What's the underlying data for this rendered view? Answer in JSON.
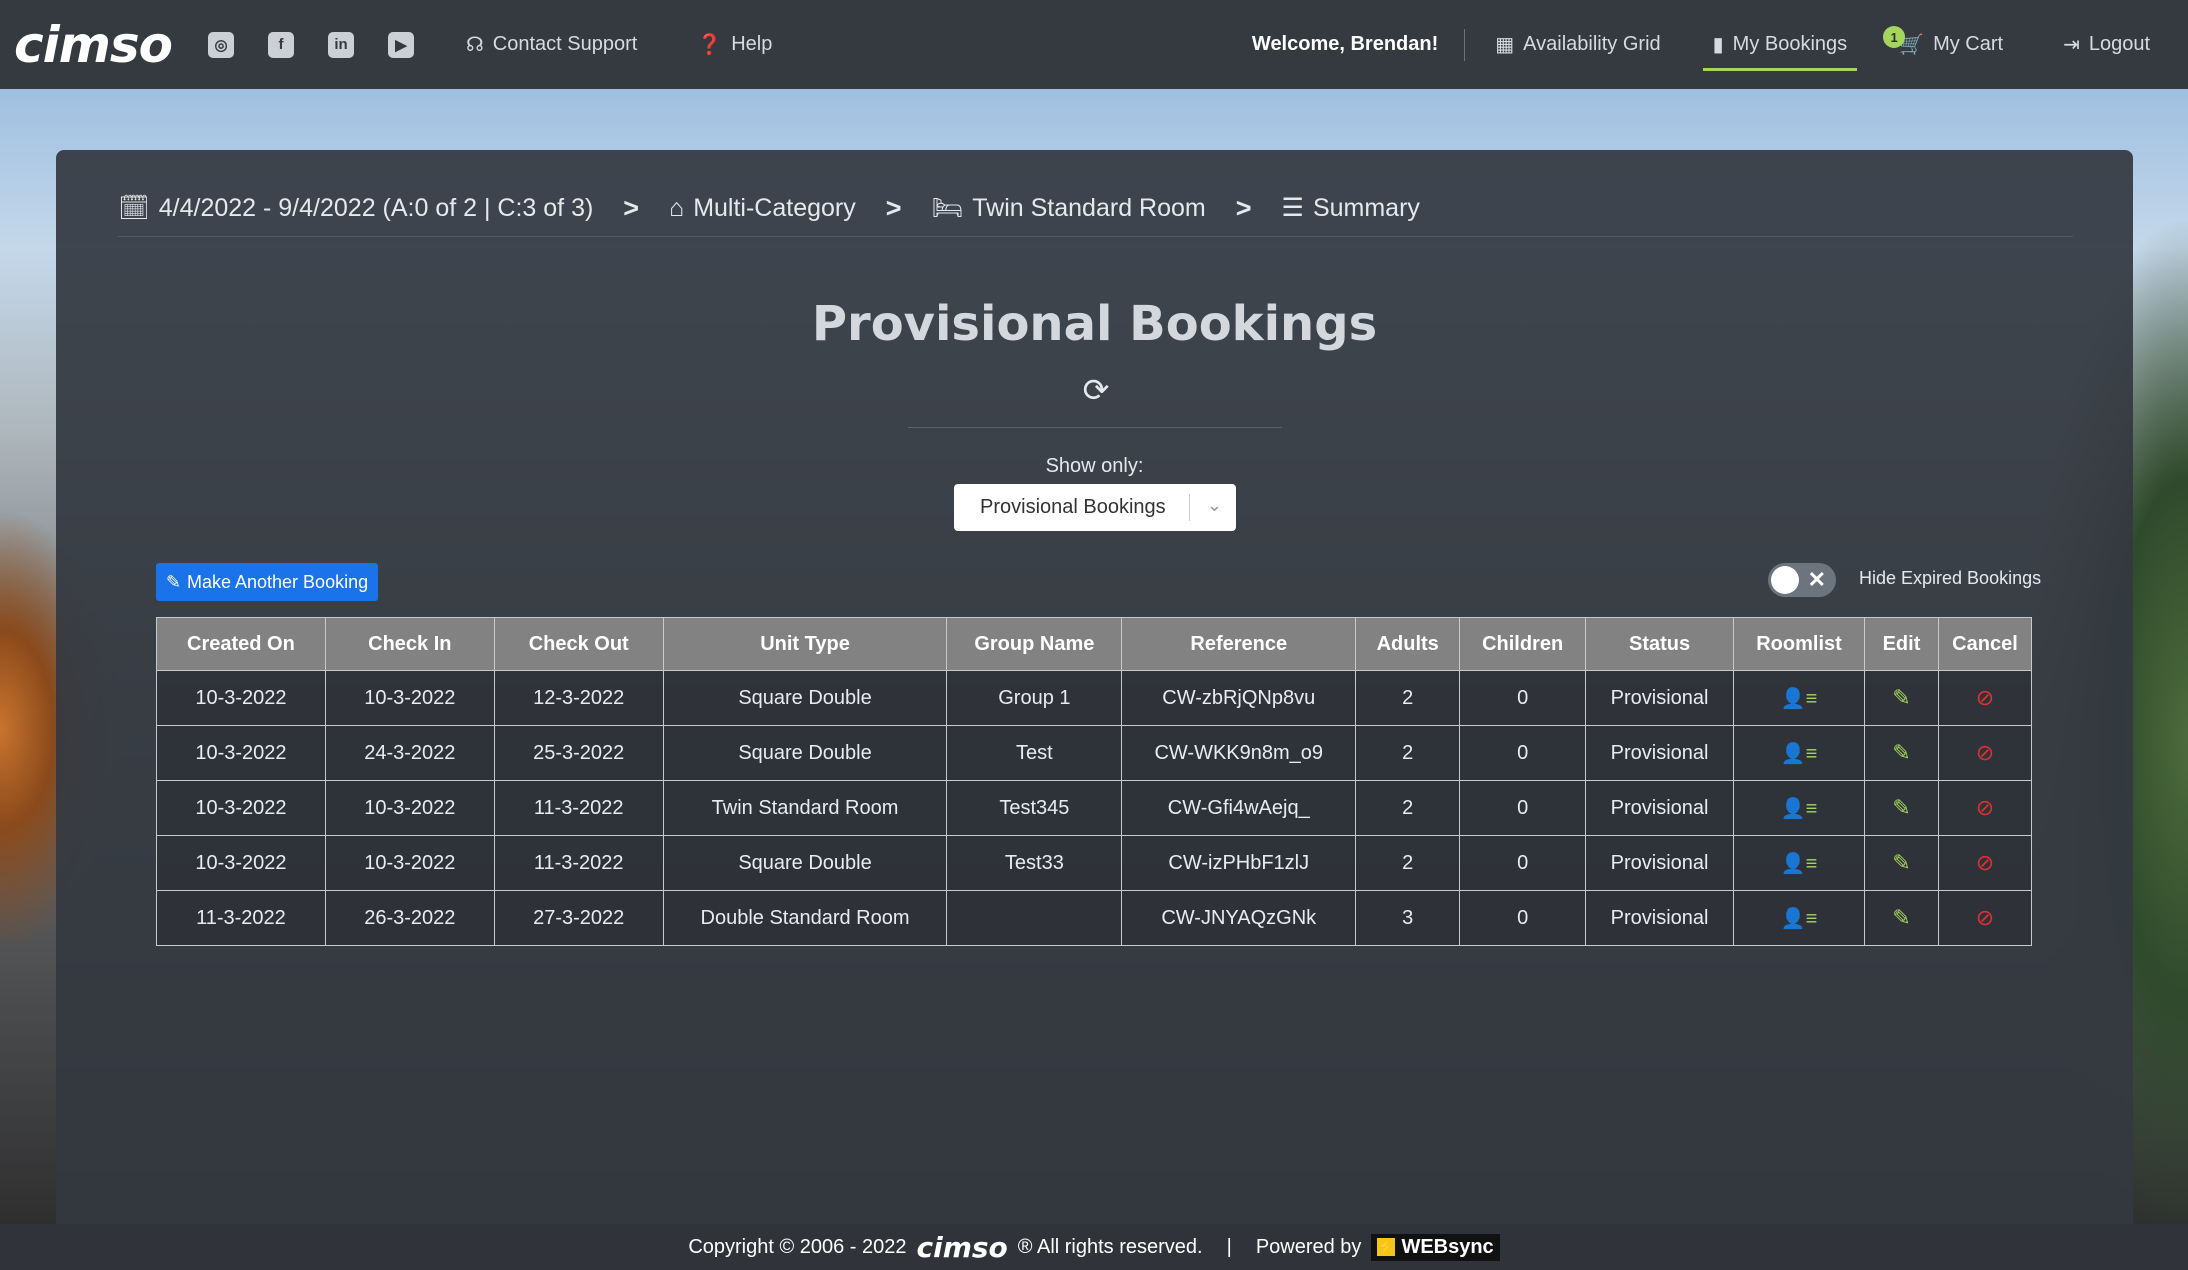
{
  "brand": "cimso",
  "nav": {
    "social_icons": [
      "instagram-icon",
      "facebook-icon",
      "linkedin-icon",
      "youtube-icon"
    ],
    "contact_support": "Contact Support",
    "help": "Help",
    "welcome": "Welcome, Brendan!",
    "availability_grid": "Availability Grid",
    "my_bookings": "My Bookings",
    "cart_count": "1",
    "my_cart": "My Cart",
    "logout": "Logout"
  },
  "breadcrumb": {
    "dates": "4/4/2022 - 9/4/2022 (A:0 of 2 | C:3 of 3)",
    "category": "Multi-Category",
    "room": "Twin Standard Room",
    "summary": "Summary",
    "separator": ">"
  },
  "page": {
    "title": "Provisional Bookings",
    "show_only_label": "Show only:",
    "filter_value": "Provisional Bookings",
    "make_booking": "Make Another Booking",
    "hide_expired": "Hide Expired Bookings"
  },
  "table": {
    "headers": [
      "Created On",
      "Check In",
      "Check Out",
      "Unit Type",
      "Group Name",
      "Reference",
      "Adults",
      "Children",
      "Status",
      "Roomlist",
      "Edit",
      "Cancel"
    ],
    "rows": [
      [
        "10-3-2022",
        "10-3-2022",
        "12-3-2022",
        "Square Double",
        "Group 1",
        "CW-zbRjQNp8vu",
        "2",
        "0",
        "Provisional"
      ],
      [
        "10-3-2022",
        "24-3-2022",
        "25-3-2022",
        "Square Double",
        "Test",
        "CW-WKK9n8m_o9",
        "2",
        "0",
        "Provisional"
      ],
      [
        "10-3-2022",
        "10-3-2022",
        "11-3-2022",
        "Twin Standard Room",
        "Test345",
        "CW-Gfi4wAejq_",
        "2",
        "0",
        "Provisional"
      ],
      [
        "10-3-2022",
        "10-3-2022",
        "11-3-2022",
        "Square Double",
        "Test33",
        "CW-izPHbF1zlJ",
        "2",
        "0",
        "Provisional"
      ],
      [
        "11-3-2022",
        "26-3-2022",
        "27-3-2022",
        "Double Standard Room",
        "",
        "CW-JNYAQzGNk",
        "3",
        "0",
        "Provisional"
      ]
    ]
  },
  "footer": {
    "copyright": "Copyright © 2006 - 2022",
    "brand": "cimso",
    "rights": "® All rights reserved.",
    "divider": "|",
    "powered_by": "Powered by",
    "partner": "WEBsync"
  },
  "colors": {
    "accent": "#a4d65e",
    "primary_button": "#1a73e8",
    "cancel": "#e03030",
    "nav_bg": "#353a41"
  }
}
